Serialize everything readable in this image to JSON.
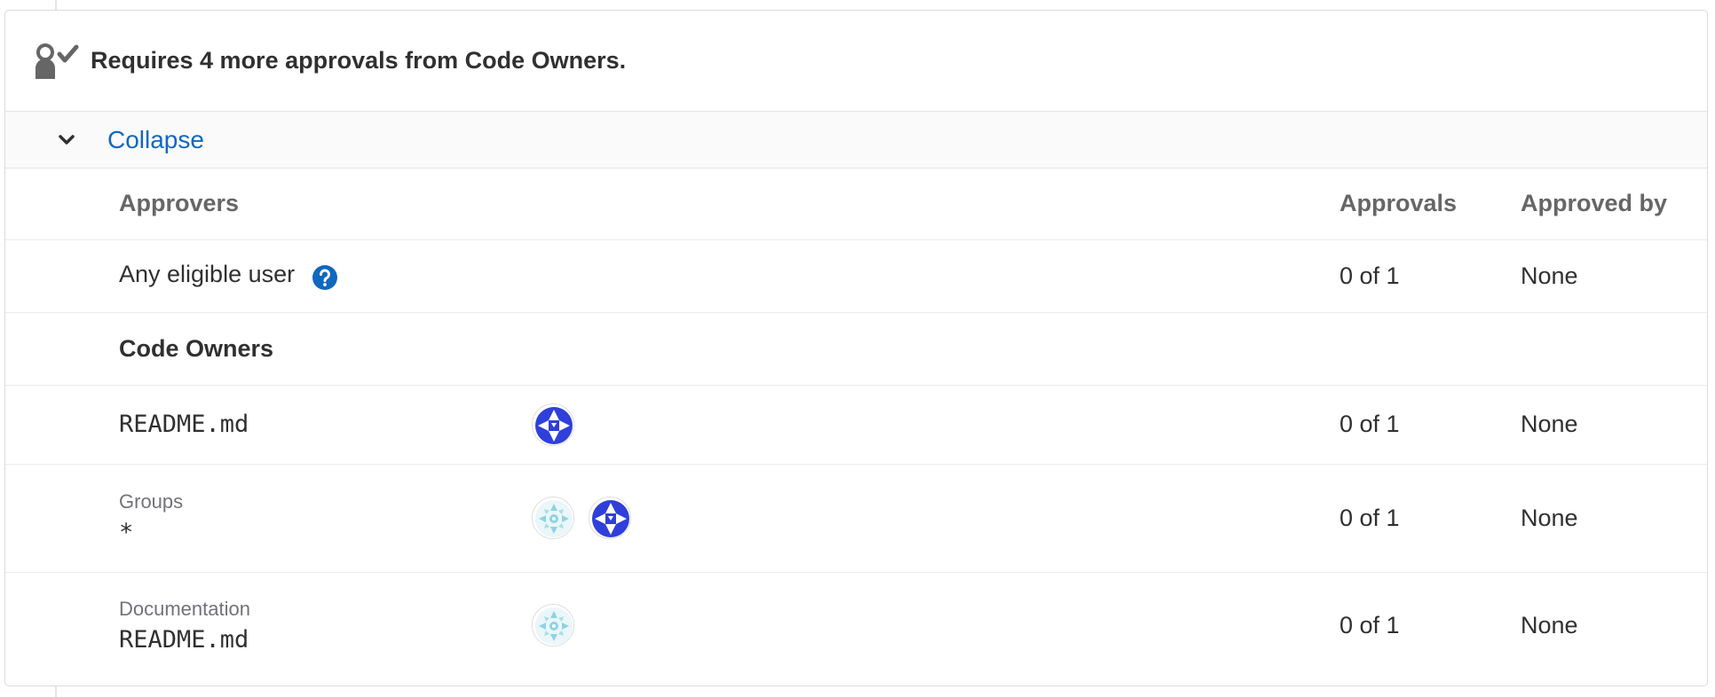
{
  "summary": {
    "icon": "approval-icon",
    "text": "Requires 4 more approvals from Code Owners."
  },
  "collapse": {
    "icon": "chevron-down-icon",
    "label": "Collapse"
  },
  "table": {
    "headers": {
      "approvers": "Approvers",
      "approvals": "Approvals",
      "approved_by": "Approved by"
    },
    "any_user": {
      "label": "Any eligible user",
      "help_icon": "question-circle-icon",
      "approvals": "0 of 1",
      "approved_by": "None"
    },
    "code_owners_heading": "Code Owners",
    "rules": [
      {
        "section": "",
        "pattern": "README.md",
        "avatars": [
          "avatar-blue-pattern"
        ],
        "approvals": "0 of 1",
        "approved_by": "None"
      },
      {
        "section": "Groups",
        "pattern": "*",
        "avatars": [
          "avatar-teal-pattern",
          "avatar-blue-pattern"
        ],
        "approvals": "0 of 1",
        "approved_by": "None"
      },
      {
        "section": "Documentation",
        "pattern": "README.md",
        "avatars": [
          "avatar-teal-pattern"
        ],
        "approvals": "0 of 1",
        "approved_by": "None"
      }
    ]
  },
  "colors": {
    "link": "#1068bf",
    "avatar_blue": "#2f3fd9",
    "avatar_teal": "#8ed3e0"
  }
}
